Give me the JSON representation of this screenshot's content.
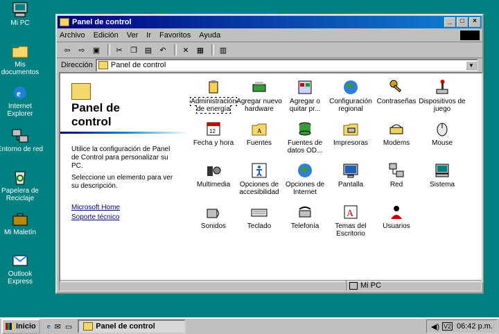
{
  "desktop": {
    "icons": [
      {
        "label": "Mi PC"
      },
      {
        "label": "Mis documentos"
      },
      {
        "label": "Internet Explorer"
      },
      {
        "label": "Entorno de red"
      },
      {
        "label": "Papelera de Reciclaje"
      },
      {
        "label": "Mi Maletín"
      },
      {
        "label": "Outlook Express"
      }
    ]
  },
  "window": {
    "title": "Panel de control",
    "menus": [
      "Archivo",
      "Edición",
      "Ver",
      "Ir",
      "Favoritos",
      "Ayuda"
    ],
    "address_label": "Dirección",
    "address_value": "Panel de control",
    "status_location": "Mi PC"
  },
  "left_pane": {
    "title_line1": "Panel de",
    "title_line2": "control",
    "text1": "Utilice la configuración de Panel de Control para personalizar su PC.",
    "text2": "Seleccione un elemento para ver su descripción.",
    "link1": "Microsoft Home",
    "link2": "Soporte técnico"
  },
  "items": [
    {
      "label": "Administración de energía",
      "icon": "power-icon"
    },
    {
      "label": "Agregar nuevo hardware",
      "icon": "hardware-icon"
    },
    {
      "label": "Agregar o quitar pr...",
      "icon": "programs-icon"
    },
    {
      "label": "Configuración regional",
      "icon": "globe-icon"
    },
    {
      "label": "Contraseñas",
      "icon": "keys-icon"
    },
    {
      "label": "Dispositivos de juego",
      "icon": "joystick-icon"
    },
    {
      "label": "Fecha y hora",
      "icon": "calendar-icon"
    },
    {
      "label": "Fuentes",
      "icon": "fonts-folder-icon"
    },
    {
      "label": "Fuentes de datos OD...",
      "icon": "odbc-icon"
    },
    {
      "label": "Impresoras",
      "icon": "printers-folder-icon"
    },
    {
      "label": "Modems",
      "icon": "modem-icon"
    },
    {
      "label": "Mouse",
      "icon": "mouse-icon"
    },
    {
      "label": "Multimedia",
      "icon": "multimedia-icon"
    },
    {
      "label": "Opciones de accesibilidad",
      "icon": "accessibility-icon"
    },
    {
      "label": "Opciones de Internet",
      "icon": "internet-options-icon"
    },
    {
      "label": "Pantalla",
      "icon": "display-icon"
    },
    {
      "label": "Red",
      "icon": "network-icon"
    },
    {
      "label": "Sistema",
      "icon": "system-icon"
    },
    {
      "label": "Sonidos",
      "icon": "sounds-icon"
    },
    {
      "label": "Teclado",
      "icon": "keyboard-icon"
    },
    {
      "label": "Telefonía",
      "icon": "telephony-icon"
    },
    {
      "label": "Temas del Escritorio",
      "icon": "themes-icon"
    },
    {
      "label": "Usuarios",
      "icon": "users-icon"
    }
  ],
  "taskbar": {
    "start_label": "Inicio",
    "task_label": "Panel de control",
    "clock": "06:42 p.m."
  },
  "colors": {
    "desktop": "#008080",
    "titlebar_start": "#000080",
    "titlebar_end": "#1084d0"
  }
}
